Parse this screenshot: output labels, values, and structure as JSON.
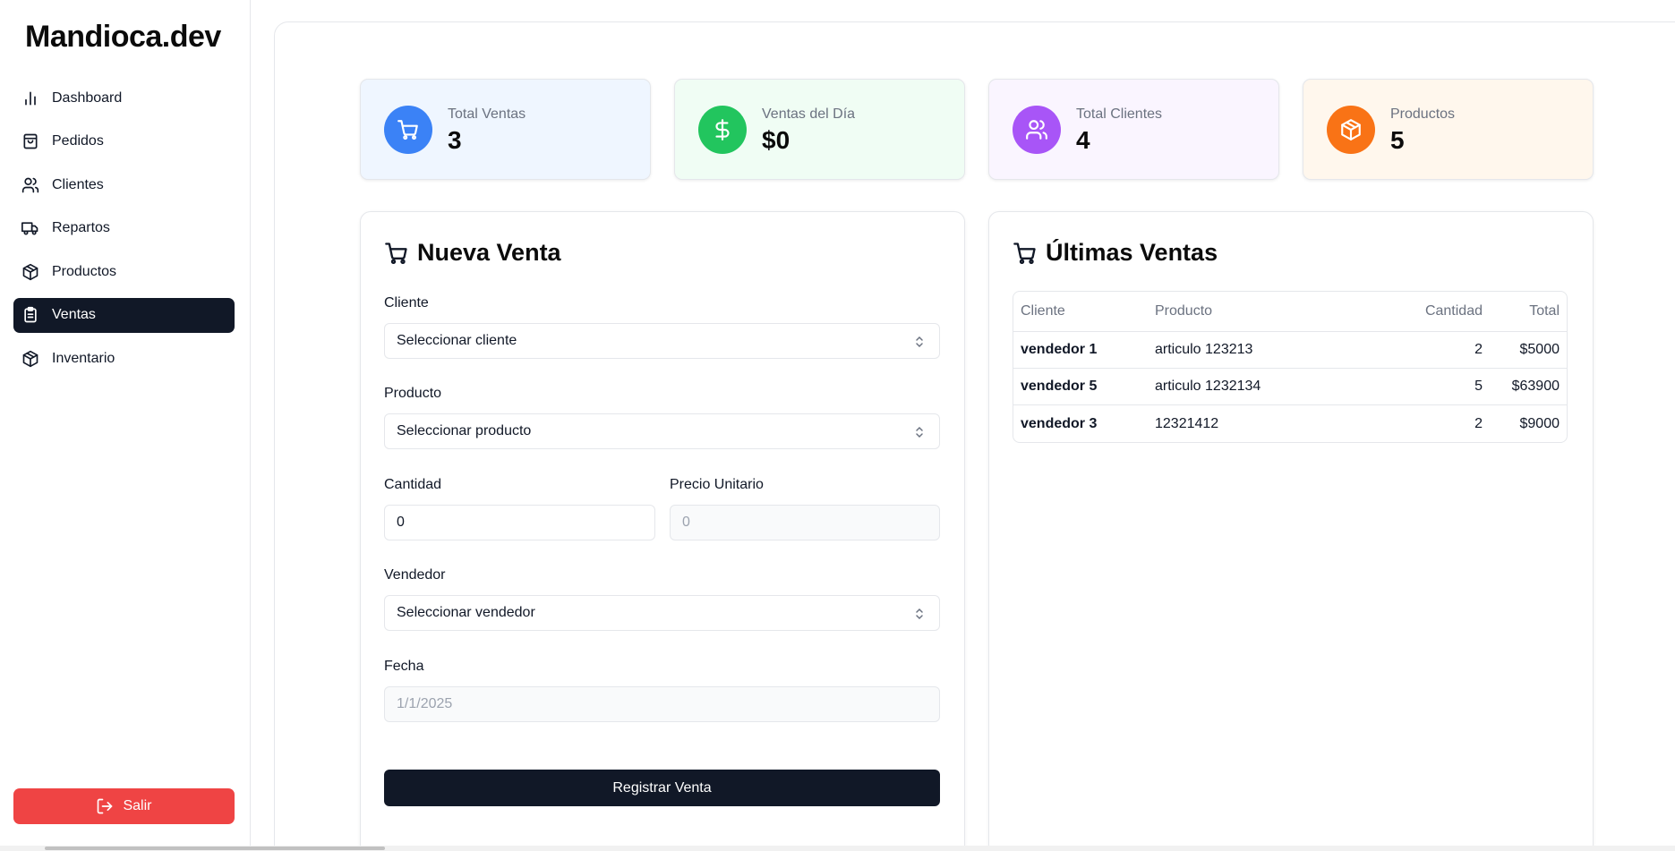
{
  "brand": "Mandioca.dev",
  "sidebar": {
    "items": [
      {
        "label": "Dashboard",
        "icon": "bar-chart-icon"
      },
      {
        "label": "Pedidos",
        "icon": "shopping-bag-icon"
      },
      {
        "label": "Clientes",
        "icon": "users-icon"
      },
      {
        "label": "Repartos",
        "icon": "truck-icon"
      },
      {
        "label": "Productos",
        "icon": "package-icon"
      },
      {
        "label": "Ventas",
        "icon": "clipboard-icon",
        "active": true
      },
      {
        "label": "Inventario",
        "icon": "package-icon"
      }
    ],
    "logout_label": "Salir"
  },
  "stats": [
    {
      "label": "Total Ventas",
      "value": "3",
      "icon": "cart-icon",
      "bg": "#eff6ff",
      "circle": "#3b82f6"
    },
    {
      "label": "Ventas del Día",
      "value": "$0",
      "icon": "dollar-icon",
      "bg": "#f0fdf4",
      "circle": "#22c55e"
    },
    {
      "label": "Total Clientes",
      "value": "4",
      "icon": "users-icon",
      "bg": "#faf5ff",
      "circle": "#a855f7"
    },
    {
      "label": "Productos",
      "value": "5",
      "icon": "package-icon",
      "bg": "#fff7ed",
      "circle": "#f97316"
    }
  ],
  "form": {
    "title": "Nueva Venta",
    "cliente_label": "Cliente",
    "cliente_value": "Seleccionar cliente",
    "producto_label": "Producto",
    "producto_value": "Seleccionar producto",
    "cantidad_label": "Cantidad",
    "cantidad_value": "0",
    "precio_label": "Precio Unitario",
    "precio_value": "0",
    "vendedor_label": "Vendedor",
    "vendedor_value": "Seleccionar vendedor",
    "fecha_label": "Fecha",
    "fecha_value": "1/1/2025",
    "submit_label": "Registrar Venta"
  },
  "sales": {
    "title": "Últimas Ventas",
    "columns": [
      "Cliente",
      "Producto",
      "Cantidad",
      "Total"
    ],
    "rows": [
      [
        "vendedor 1",
        "articulo 123213",
        "2",
        "$5000"
      ],
      [
        "vendedor 5",
        "articulo 1232134",
        "5",
        "$63900"
      ],
      [
        "vendedor 3",
        "12321412",
        "2",
        "$9000"
      ]
    ]
  },
  "colors": {
    "primary": "#111827",
    "danger": "#ef4444"
  }
}
